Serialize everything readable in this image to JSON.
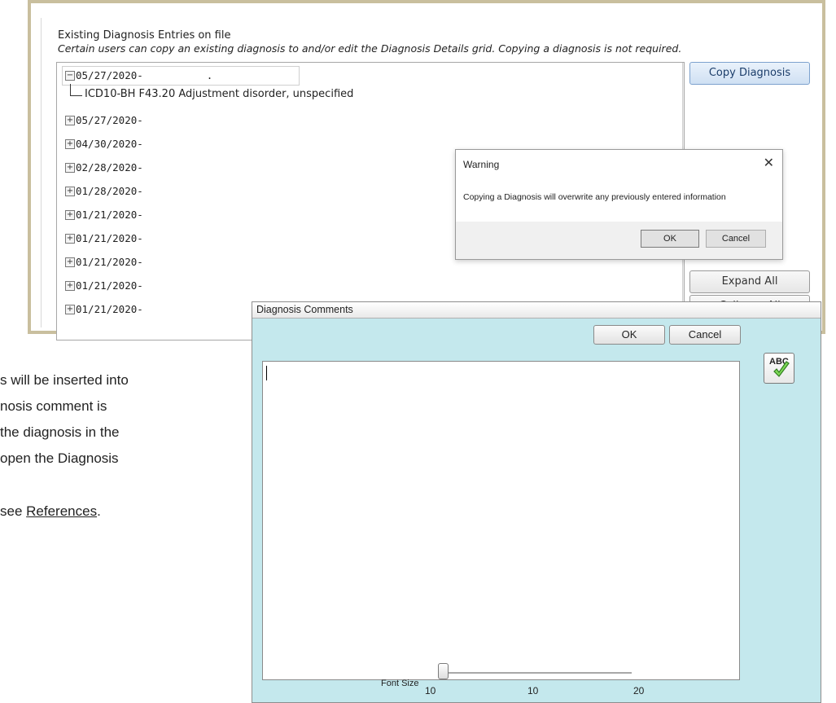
{
  "background_text": {
    "line1": "s will be inserted into",
    "line2": "nosis comment is",
    "line3": "the diagnosis in the",
    "line4": "open the Diagnosis",
    "line5_prefix": "see ",
    "line5_link": "References",
    "line5_suffix": "."
  },
  "existing": {
    "heading": "Existing Diagnosis Entries on file",
    "subheading": "Certain users can copy an existing diagnosis to and/or edit the Diagnosis Details grid.  Copying a diagnosis is not required.",
    "tree": [
      {
        "label": "05/27/2020-",
        "suffix": ".",
        "expanded": true,
        "child": "ICD10-BH F43.20 Adjustment disorder, unspecified"
      },
      {
        "label": "05/27/2020-",
        "expanded": false
      },
      {
        "label": "04/30/2020-",
        "expanded": false
      },
      {
        "label": "02/28/2020-",
        "expanded": false
      },
      {
        "label": "01/28/2020-",
        "expanded": false
      },
      {
        "label": "01/21/2020-",
        "expanded": false
      },
      {
        "label": "01/21/2020-",
        "expanded": false
      },
      {
        "label": "01/21/2020-",
        "expanded": false
      },
      {
        "label": "01/21/2020-",
        "expanded": false
      },
      {
        "label": "01/21/2020-",
        "expanded": false
      }
    ],
    "expanded_symbol": "−",
    "collapsed_symbol": "+",
    "copy_button": "Copy Diagnosis",
    "expand_all_button": "Expand All",
    "collapse_all_button": "Collapse All"
  },
  "warning_dialog": {
    "title": "Warning",
    "close": "✕",
    "message": "Copying a Diagnosis will overwrite any previously entered information",
    "ok": "OK",
    "cancel": "Cancel"
  },
  "comments_window": {
    "title": "Diagnosis Comments",
    "ok": "OK",
    "cancel": "Cancel",
    "spellcheck_label": "ABC",
    "font_size_label": "Font Size",
    "font_size_value": 10,
    "slider_min": "10",
    "slider_mid": "10",
    "slider_max": "20"
  },
  "colors": {
    "frame": "#c9bf9e",
    "dialog_bg": "#c4e8ed",
    "copy_button": "#cfe0f3"
  }
}
